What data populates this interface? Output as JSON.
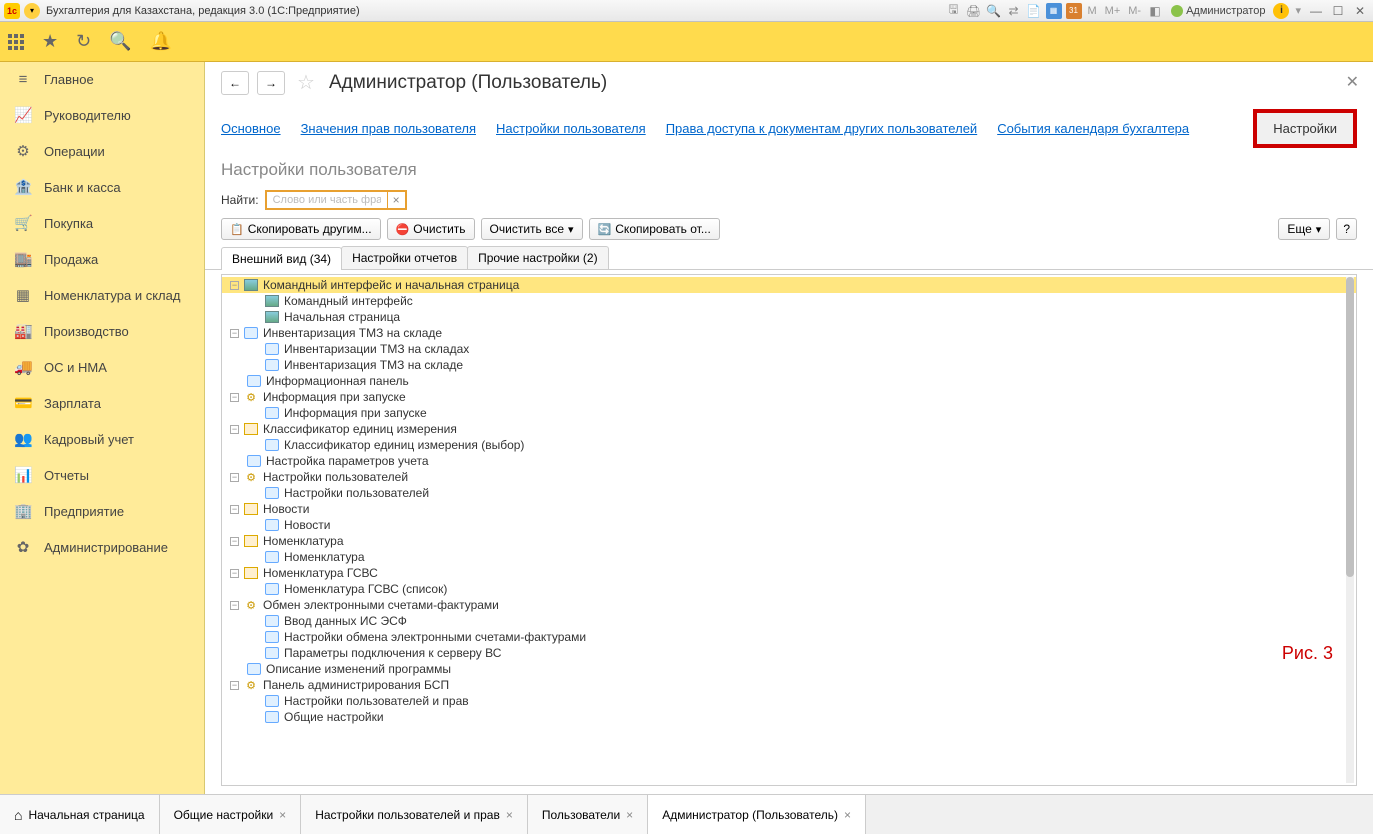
{
  "titlebar": {
    "title": "Бухгалтерия для Казахстана, редакция 3.0  (1С:Предприятие)",
    "user": "Администратор",
    "m_items": [
      "M",
      "M+",
      "M-"
    ]
  },
  "sidebar": {
    "items": [
      {
        "icon": "≡",
        "label": "Главное"
      },
      {
        "icon": "📈",
        "label": "Руководителю"
      },
      {
        "icon": "⚙",
        "label": "Операции"
      },
      {
        "icon": "🏦",
        "label": "Банк и касса"
      },
      {
        "icon": "🛒",
        "label": "Покупка"
      },
      {
        "icon": "🏬",
        "label": "Продажа"
      },
      {
        "icon": "▦",
        "label": "Номенклатура и склад"
      },
      {
        "icon": "🏭",
        "label": "Производство"
      },
      {
        "icon": "🚚",
        "label": "ОС и НМА"
      },
      {
        "icon": "💳",
        "label": "Зарплата"
      },
      {
        "icon": "👥",
        "label": "Кадровый учет"
      },
      {
        "icon": "📊",
        "label": "Отчеты"
      },
      {
        "icon": "🏢",
        "label": "Предприятие"
      },
      {
        "icon": "✿",
        "label": "Администрирование"
      }
    ]
  },
  "page": {
    "title": "Администратор (Пользователь)",
    "navlinks": [
      "Основное",
      "Значения прав пользователя",
      "Настройки пользователя",
      "Права доступа к документам других пользователей",
      "События календаря бухгалтера"
    ],
    "active_navlink": "Настройки",
    "section": "Настройки пользователя",
    "search_label": "Найти:",
    "search_placeholder": "Слово или часть фразы",
    "buttons": {
      "copy_others": "Скопировать другим...",
      "clear": "Очистить",
      "clear_all": "Очистить все",
      "copy_from": "Скопировать от...",
      "more": "Еще"
    },
    "tabs": [
      {
        "label": "Внешний вид (34)",
        "active": true
      },
      {
        "label": "Настройки отчетов",
        "active": false
      },
      {
        "label": "Прочие настройки (2)",
        "active": false
      }
    ],
    "fig_label": "Рис. 3"
  },
  "tree": [
    {
      "lvl": 0,
      "toggle": "minus",
      "icon": "img",
      "label": "Командный интерфейс и начальная страница",
      "selected": true
    },
    {
      "lvl": 1,
      "toggle": "",
      "icon": "img",
      "label": "Командный интерфейс"
    },
    {
      "lvl": 1,
      "toggle": "",
      "icon": "img",
      "label": "Начальная страница"
    },
    {
      "lvl": 0,
      "toggle": "minus",
      "icon": "form",
      "label": "Инвентаризация ТМЗ на складе"
    },
    {
      "lvl": 1,
      "toggle": "",
      "icon": "form",
      "label": "Инвентаризации ТМЗ на складах"
    },
    {
      "lvl": 1,
      "toggle": "",
      "icon": "form",
      "label": "Инвентаризация ТМЗ на складе"
    },
    {
      "lvl": 0,
      "toggle": "",
      "icon": "form",
      "label": "Информационная панель"
    },
    {
      "lvl": 0,
      "toggle": "minus",
      "icon": "gear",
      "label": "Информация при запуске"
    },
    {
      "lvl": 1,
      "toggle": "",
      "icon": "form",
      "label": "Информация при запуске"
    },
    {
      "lvl": 0,
      "toggle": "minus",
      "icon": "cat",
      "label": "Классификатор единиц измерения"
    },
    {
      "lvl": 1,
      "toggle": "",
      "icon": "form",
      "label": "Классификатор единиц измерения (выбор)"
    },
    {
      "lvl": 0,
      "toggle": "",
      "icon": "form",
      "label": "Настройка параметров учета"
    },
    {
      "lvl": 0,
      "toggle": "minus",
      "icon": "gear",
      "label": "Настройки пользователей"
    },
    {
      "lvl": 1,
      "toggle": "",
      "icon": "form",
      "label": "Настройки пользователей"
    },
    {
      "lvl": 0,
      "toggle": "minus",
      "icon": "cat",
      "label": "Новости"
    },
    {
      "lvl": 1,
      "toggle": "",
      "icon": "form",
      "label": "Новости"
    },
    {
      "lvl": 0,
      "toggle": "minus",
      "icon": "cat",
      "label": "Номенклатура"
    },
    {
      "lvl": 1,
      "toggle": "",
      "icon": "form",
      "label": "Номенклатура"
    },
    {
      "lvl": 0,
      "toggle": "minus",
      "icon": "cat",
      "label": "Номенклатура ГСВС"
    },
    {
      "lvl": 1,
      "toggle": "",
      "icon": "form",
      "label": "Номенклатура ГСВС (список)"
    },
    {
      "lvl": 0,
      "toggle": "minus",
      "icon": "gear",
      "label": "Обмен электронными счетами-фактурами"
    },
    {
      "lvl": 1,
      "toggle": "",
      "icon": "form",
      "label": "Ввод данных ИС ЭСФ"
    },
    {
      "lvl": 1,
      "toggle": "",
      "icon": "form",
      "label": "Настройки обмена электронными счетами-фактурами"
    },
    {
      "lvl": 1,
      "toggle": "",
      "icon": "form",
      "label": "Параметры подключения к серверу ВС"
    },
    {
      "lvl": 0,
      "toggle": "",
      "icon": "form",
      "label": "Описание изменений программы"
    },
    {
      "lvl": 0,
      "toggle": "minus",
      "icon": "gear",
      "label": "Панель администрирования БСП"
    },
    {
      "lvl": 1,
      "toggle": "",
      "icon": "form",
      "label": "Настройки пользователей и прав"
    },
    {
      "lvl": 1,
      "toggle": "",
      "icon": "form",
      "label": "Общие настройки"
    }
  ],
  "bottom_tabs": [
    {
      "label": "Начальная страница",
      "home": true,
      "closable": false
    },
    {
      "label": "Общие настройки",
      "closable": true
    },
    {
      "label": "Настройки пользователей и прав",
      "closable": true
    },
    {
      "label": "Пользователи",
      "closable": true
    },
    {
      "label": "Администратор (Пользователь)",
      "closable": true,
      "active": true
    }
  ]
}
